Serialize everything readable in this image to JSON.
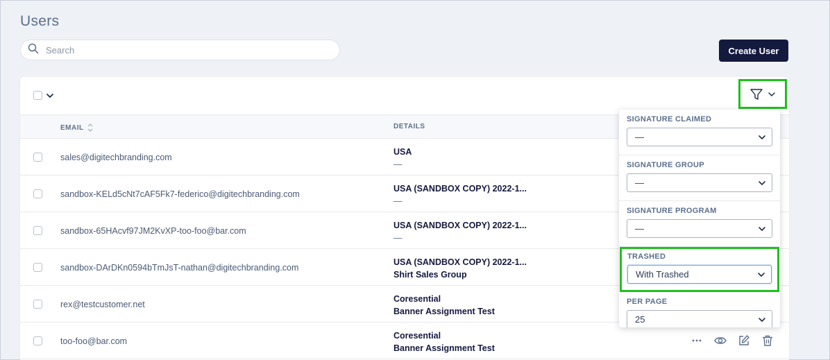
{
  "page": {
    "title": "Users"
  },
  "search": {
    "placeholder": "Search",
    "value": ""
  },
  "header": {
    "create_button": "Create User"
  },
  "table": {
    "columns": {
      "email": "EMAIL",
      "details": "DETAILS"
    },
    "rows": [
      {
        "email": "sales@digitechbranding.com",
        "detail_1": "USA",
        "detail_2": "—"
      },
      {
        "email": "sandbox-KELd5cNt7cAF5Fk7-federico@digitechbranding.com",
        "detail_1": "USA (SANDBOX COPY) 2022-1...",
        "detail_2": "—"
      },
      {
        "email": "sandbox-65HAcvf97JM2KvXP-too-foo@bar.com",
        "detail_1": "USA (SANDBOX COPY) 2022-1...",
        "detail_2": "—"
      },
      {
        "email": "sandbox-DArDKn0594bTmJsT-nathan@digitechbranding.com",
        "detail_1": "USA (SANDBOX COPY) 2022-1...",
        "detail_2": "Shirt Sales Group"
      },
      {
        "email": "rex@testcustomer.net",
        "detail_1": "Coresential",
        "detail_2": "Banner Assignment Test"
      },
      {
        "email": "too-foo@bar.com",
        "detail_1": "Coresential",
        "detail_2": "Banner Assignment Test"
      }
    ]
  },
  "filters": {
    "signature_claimed": {
      "label": "SIGNATURE CLAIMED",
      "value": "—"
    },
    "signature_group": {
      "label": "SIGNATURE GROUP",
      "value": "—"
    },
    "signature_program": {
      "label": "SIGNATURE PROGRAM",
      "value": "—"
    },
    "trashed": {
      "label": "TRASHED",
      "value": "With Trashed"
    },
    "per_page": {
      "label": "PER PAGE",
      "value": "25"
    }
  },
  "icons": {
    "search": "search-icon",
    "filter": "filter-icon",
    "chevron": "chevron-down-icon",
    "sort": "sort-icon",
    "more": "more-icon",
    "view": "eye-icon",
    "edit": "edit-icon",
    "delete": "trash-icon"
  },
  "colors": {
    "primary": "#14193e",
    "highlight": "#1fc01f",
    "background": "#eef1f6"
  }
}
